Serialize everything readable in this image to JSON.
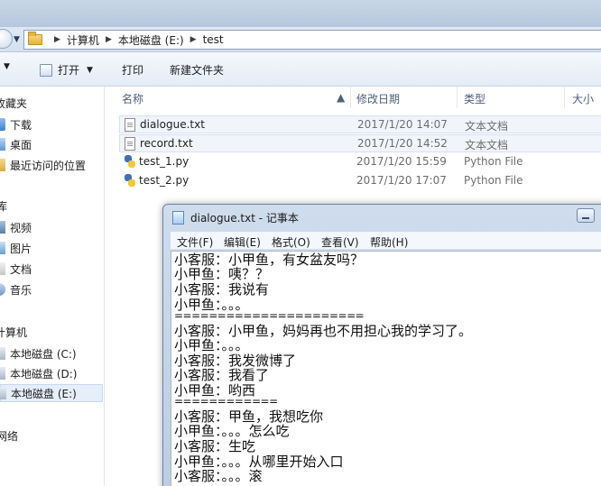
{
  "background_strip_text": "",
  "address": {
    "crumbs": [
      "计算机",
      "本地磁盘 (E:)",
      "test"
    ]
  },
  "toolbar": {
    "open_label": "打开",
    "print_label": "打印",
    "new_folder_label": "新建文件夹"
  },
  "nav": {
    "favorites_header": "收藏夹",
    "favorites": [
      "下载",
      "桌面",
      "最近访问的位置"
    ],
    "libraries_header": "库",
    "libraries": [
      "视频",
      "图片",
      "文档",
      "音乐"
    ],
    "computer_header": "计算机",
    "drives": [
      "本地磁盘 (C:)",
      "本地磁盘 (D:)",
      "本地磁盘 (E:)"
    ],
    "network_header": "网络"
  },
  "columns": {
    "name": "名称",
    "date": "修改日期",
    "type": "类型",
    "size": "大小"
  },
  "files": [
    {
      "name": "dialogue.txt",
      "date": "2017/1/20 14:07",
      "type": "文本文档",
      "icon": "text-file-icon"
    },
    {
      "name": "record.txt",
      "date": "2017/1/20 14:52",
      "type": "文本文档",
      "icon": "text-file-icon"
    },
    {
      "name": "test_1.py",
      "date": "2017/1/20 15:59",
      "type": "Python File",
      "icon": "python-file-icon"
    },
    {
      "name": "test_2.py",
      "date": "2017/1/20 17:07",
      "type": "Python File",
      "icon": "python-file-icon"
    }
  ],
  "notepad": {
    "title": "dialogue.txt - 记事本",
    "menu": [
      "文件(F)",
      "编辑(E)",
      "格式(O)",
      "查看(V)",
      "帮助(H)"
    ],
    "lines": [
      "小客服：小甲鱼，有女盆友吗？",
      "小甲鱼：咦？？",
      "小客服：我说有",
      "小甲鱼：。。。",
      "======================",
      "小客服：小甲鱼，妈妈再也不用担心我的学习了。",
      "小甲鱼：。。。",
      "小客服：我发微博了",
      "小客服：我看了",
      "小甲鱼：哟西",
      "============",
      "小客服：甲鱼，我想吃你",
      "小甲鱼：。。。怎么吃",
      "小客服：生吃",
      "小甲鱼：。。。从哪里开始入口",
      "小客服：。。。滚"
    ]
  }
}
